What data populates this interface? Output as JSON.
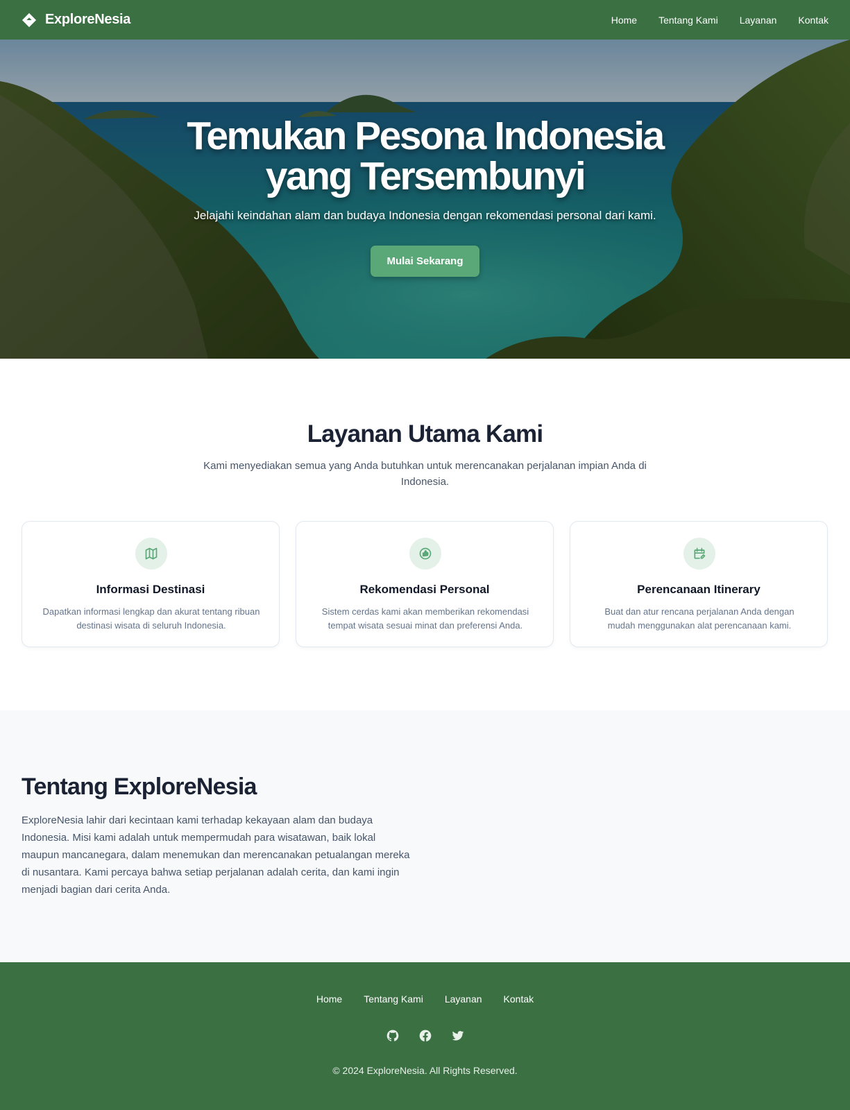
{
  "nav": {
    "brand": "ExploreNesia",
    "links": [
      "Home",
      "Tentang Kami",
      "Layanan",
      "Kontak"
    ]
  },
  "hero": {
    "title_line1": "Temukan Pesona Indonesia",
    "title_line2": "yang Tersembunyi",
    "subtitle": "Jelajahi keindahan alam dan budaya Indonesia dengan rekomendasi personal dari kami.",
    "cta_label": "Mulai Sekarang"
  },
  "services": {
    "title": "Layanan Utama Kami",
    "subtitle": "Kami menyediakan semua yang Anda butuhkan untuk merencanakan perjalanan impian Anda di Indonesia.",
    "cards": [
      {
        "icon": "map-icon",
        "title": "Informasi Destinasi",
        "description": "Dapatkan informasi lengkap dan akurat tentang ribuan destinasi wisata di seluruh Indonesia."
      },
      {
        "icon": "thumbs-up-icon",
        "title": "Rekomendasi Personal",
        "description": "Sistem cerdas kami akan memberikan rekomendasi tempat wisata sesuai minat dan preferensi Anda."
      },
      {
        "icon": "calendar-edit-icon",
        "title": "Perencanaan Itinerary",
        "description": "Buat dan atur rencana perjalanan Anda dengan mudah menggunakan alat perencanaan kami."
      }
    ]
  },
  "about": {
    "title": "Tentang ExploreNesia",
    "text": "ExploreNesia lahir dari kecintaan kami terhadap kekayaan alam dan budaya Indonesia. Misi kami adalah untuk mempermudah para wisatawan, baik lokal maupun mancanegara, dalam menemukan dan merencanakan petualangan mereka di nusantara. Kami percaya bahwa setiap perjalanan adalah cerita, dan kami ingin menjadi bagian dari cerita Anda."
  },
  "footer": {
    "links": [
      "Home",
      "Tentang Kami",
      "Layanan",
      "Kontak"
    ],
    "social": [
      "github-icon",
      "facebook-icon",
      "twitter-icon"
    ],
    "copyright": "© 2024 ExploreNesia. All Rights Reserved."
  },
  "colors": {
    "primary_green": "#3b7043",
    "button_green": "#5aa877",
    "icon_bg": "#e4f1e8",
    "heading_dark": "#1a2233",
    "about_bg": "#f7f9fb"
  }
}
